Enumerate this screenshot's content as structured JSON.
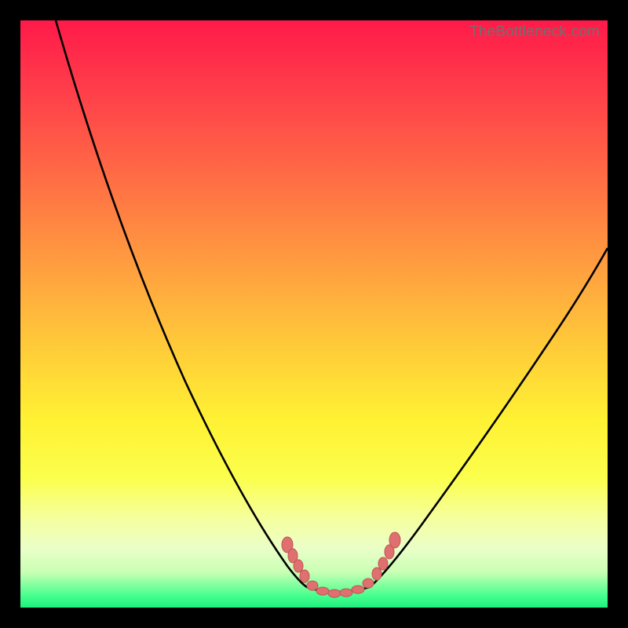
{
  "watermark": "TheBottleneck.com",
  "chart_data": {
    "type": "line",
    "title": "",
    "xlabel": "",
    "ylabel": "",
    "xlim": [
      0,
      100
    ],
    "ylim": [
      0,
      100
    ],
    "background_gradient": {
      "direction": "vertical",
      "stops": [
        {
          "pos": 0.0,
          "color": "#ff1a49"
        },
        {
          "pos": 0.12,
          "color": "#ff3e4a"
        },
        {
          "pos": 0.26,
          "color": "#ff6a45"
        },
        {
          "pos": 0.4,
          "color": "#ff9840"
        },
        {
          "pos": 0.54,
          "color": "#ffc63a"
        },
        {
          "pos": 0.68,
          "color": "#fff133"
        },
        {
          "pos": 0.78,
          "color": "#fbff4d"
        },
        {
          "pos": 0.85,
          "color": "#f5ffa0"
        },
        {
          "pos": 0.9,
          "color": "#eaffc8"
        },
        {
          "pos": 0.94,
          "color": "#c9ffb4"
        },
        {
          "pos": 0.98,
          "color": "#46ff8e"
        },
        {
          "pos": 1.0,
          "color": "#1ff07e"
        }
      ]
    },
    "series": [
      {
        "name": "left-curve",
        "x": [
          6,
          10,
          15,
          20,
          25,
          30,
          35,
          40,
          43,
          46,
          48
        ],
        "y": [
          100,
          88,
          74,
          61,
          49,
          38,
          28,
          18,
          12,
          8,
          5
        ]
      },
      {
        "name": "valley-floor",
        "x": [
          48,
          50,
          52,
          54,
          56,
          58,
          60
        ],
        "y": [
          5,
          4,
          4,
          4,
          4,
          4,
          5
        ]
      },
      {
        "name": "right-curve",
        "x": [
          60,
          63,
          67,
          72,
          78,
          85,
          92,
          100
        ],
        "y": [
          5,
          8,
          13,
          20,
          29,
          40,
          51,
          62
        ]
      }
    ],
    "markers": {
      "name": "valley-dots",
      "color": "#e07070",
      "points": [
        {
          "x": 45,
          "y": 12
        },
        {
          "x": 46,
          "y": 11
        },
        {
          "x": 47,
          "y": 9
        },
        {
          "x": 48,
          "y": 7
        },
        {
          "x": 49,
          "y": 5
        },
        {
          "x": 51,
          "y": 4
        },
        {
          "x": 53,
          "y": 4
        },
        {
          "x": 55,
          "y": 4
        },
        {
          "x": 57,
          "y": 4
        },
        {
          "x": 59,
          "y": 5
        },
        {
          "x": 61,
          "y": 7
        },
        {
          "x": 62,
          "y": 9
        },
        {
          "x": 63,
          "y": 11
        },
        {
          "x": 64,
          "y": 13
        }
      ]
    }
  }
}
